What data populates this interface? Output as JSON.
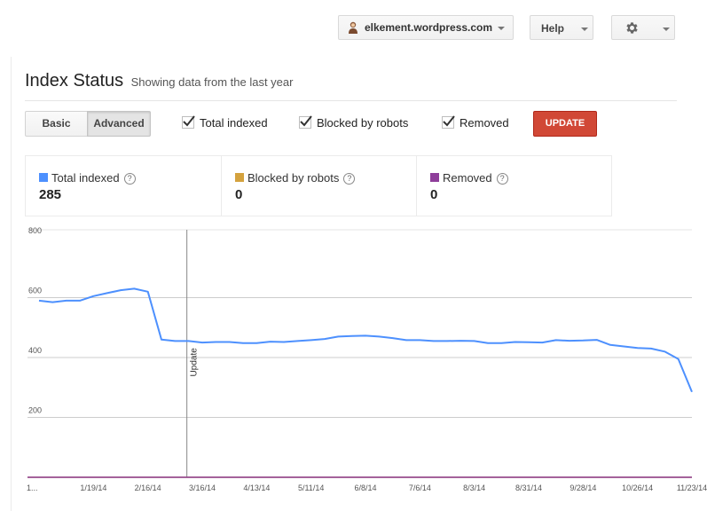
{
  "header": {
    "account_label": "elkement.wordpress.com",
    "help_label": "Help"
  },
  "page": {
    "title": "Index Status",
    "subtitle": "Showing data from the last year"
  },
  "toolbar": {
    "basic_label": "Basic",
    "advanced_label": "Advanced",
    "checkboxes": [
      {
        "label": "Total indexed",
        "checked": true
      },
      {
        "label": "Blocked by robots",
        "checked": true
      },
      {
        "label": "Removed",
        "checked": true
      }
    ],
    "update_label": "UPDATE",
    "update_color": "#d14836"
  },
  "summary": [
    {
      "name": "Total indexed",
      "value": "285",
      "color": "#4d90fe"
    },
    {
      "name": "Blocked by robots",
      "value": "0",
      "color": "#d4a23e"
    },
    {
      "name": "Removed",
      "value": "0",
      "color": "#8e3e9a"
    }
  ],
  "chart_data": {
    "type": "line",
    "ylim": [
      0,
      800
    ],
    "yticks": [
      "800",
      "600",
      "400",
      "200"
    ],
    "x_tick_labels": [
      "1...",
      "1/19/14",
      "2/16/14",
      "3/16/14",
      "4/13/14",
      "5/11/14",
      "6/8/14",
      "7/6/14",
      "8/3/14",
      "8/31/14",
      "9/28/14",
      "10/26/14",
      "11/23/14"
    ],
    "annotation": "Update",
    "annotation_index": 11,
    "grid": true,
    "series": [
      {
        "name": "Total indexed",
        "color": "#4d90fe",
        "values": [
          590,
          585,
          590,
          590,
          605,
          615,
          625,
          630,
          620,
          460,
          455,
          455,
          450,
          452,
          452,
          448,
          448,
          453,
          452,
          455,
          458,
          462,
          470,
          472,
          473,
          470,
          465,
          458,
          458,
          455,
          455,
          456,
          455,
          448,
          448,
          452,
          451,
          450,
          458,
          456,
          457,
          459,
          442,
          437,
          432,
          430,
          420,
          395,
          285
        ]
      },
      {
        "name": "Blocked by robots",
        "color": "#d4a23e",
        "values": [
          0,
          0
        ]
      },
      {
        "name": "Removed",
        "color": "#8e3e9a",
        "values": [
          0,
          0
        ]
      }
    ]
  }
}
